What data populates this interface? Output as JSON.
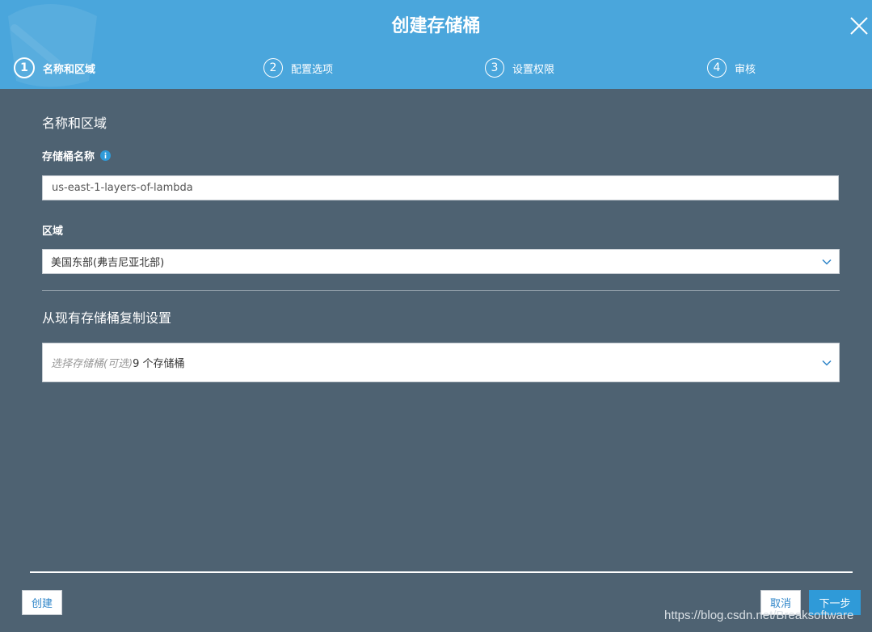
{
  "dialog": {
    "title": "创建存储桶",
    "steps": [
      {
        "num": "1",
        "label": "名称和区域",
        "active": true
      },
      {
        "num": "2",
        "label": "配置选项",
        "active": false
      },
      {
        "num": "3",
        "label": "设置权限",
        "active": false
      },
      {
        "num": "4",
        "label": "审核",
        "active": false
      }
    ]
  },
  "form": {
    "section_title": "名称和区域",
    "bucket_name_label": "存储桶名称",
    "bucket_name_value": "us-east-1-layers-of-lambda",
    "region_label": "区域",
    "region_value": "美国东部(弗吉尼亚北部)",
    "copy_section_title": "从现有存储桶复制设置",
    "copy_placeholder": "选择存储桶(可选)",
    "copy_count": "9 个存储桶"
  },
  "footer": {
    "create_label": "创建",
    "cancel_label": "取消",
    "next_label": "下一步"
  },
  "watermark": "https://blog.csdn.net/Breaksoftware",
  "colors": {
    "header": "#4aa6dc",
    "background": "#4e6272",
    "primary_button": "#2f9ad8",
    "link": "#2d84c8"
  }
}
